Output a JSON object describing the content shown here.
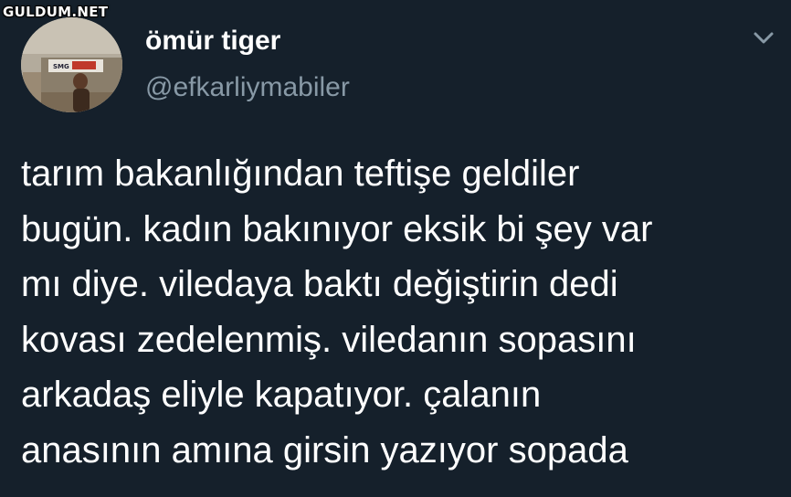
{
  "watermark": {
    "text": "GULDUM.NET"
  },
  "tweet": {
    "author": {
      "display_name": "ömür tiger",
      "handle": "@efkarliymabiler",
      "avatar_sign_text": "SMG"
    },
    "menu_icon": "chevron-down-icon",
    "text": "tarım bakanlığından teftişe geldiler\nbugün. kadın bakınıyor eksik bi şey var\nmı diye. viledaya baktı değiştirin dedi\nkovası zedelenmiş. viledanın sopasını\narkadaş eliyle kapatıyor. çalanın\nanasının amına girsin yazıyor sopada"
  },
  "colors": {
    "background": "#15202b",
    "primary_text": "#ffffff",
    "secondary_text": "#8899a6"
  }
}
